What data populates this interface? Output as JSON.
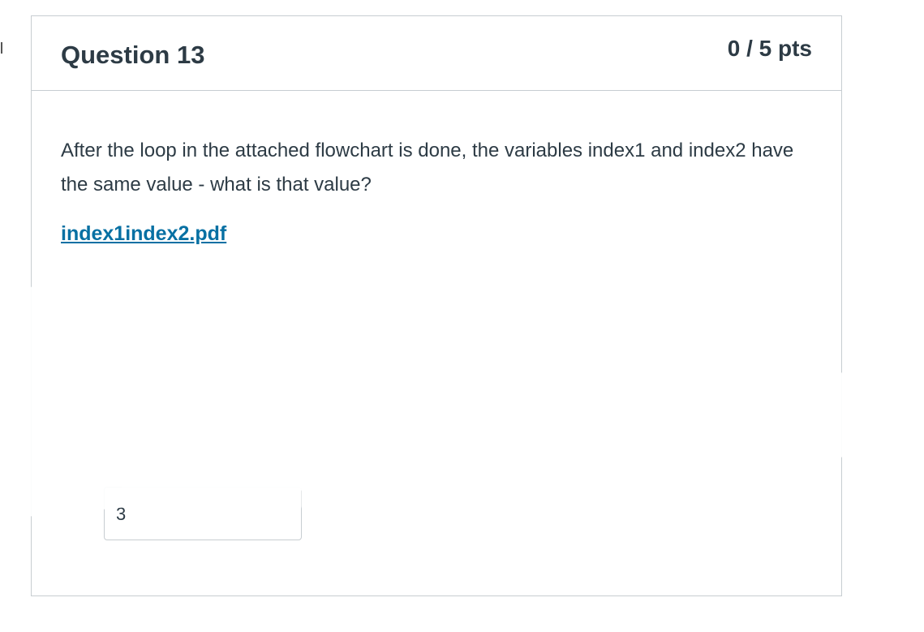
{
  "question": {
    "title": "Question 13",
    "points": "0 / 5 pts",
    "text": "After the loop in the attached flowchart is done, the variables index1 and index2 have the same value - what is that value?",
    "attachment_label": "index1index2.pdf",
    "answer_value": "3"
  }
}
